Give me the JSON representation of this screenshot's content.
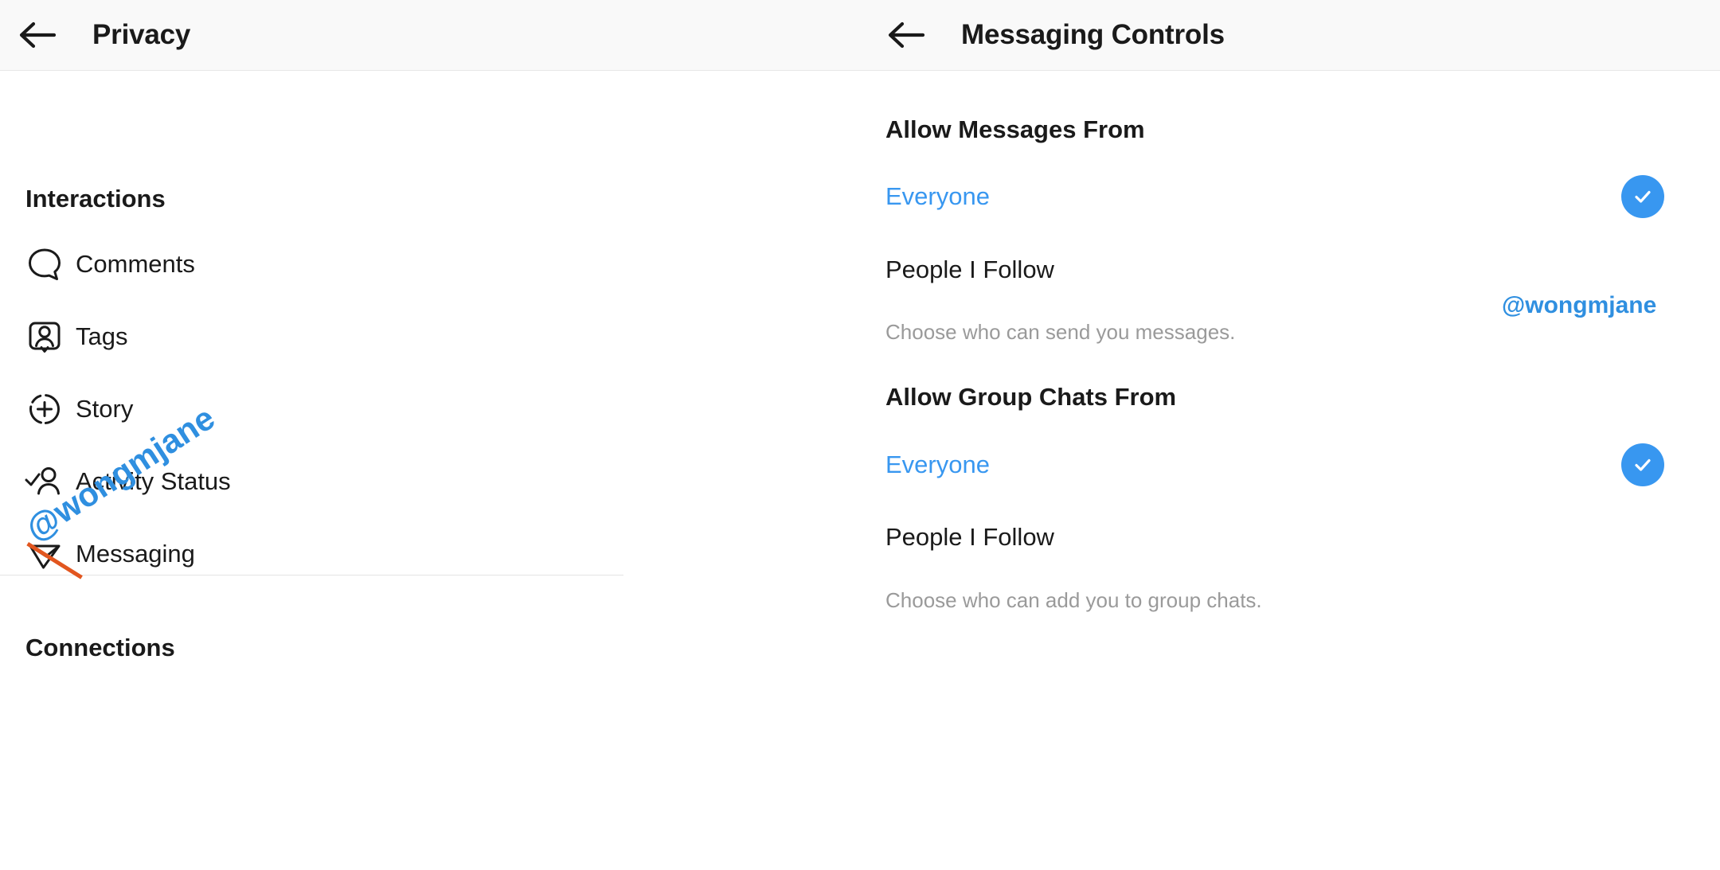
{
  "left_panel": {
    "header": {
      "back_icon": "back-arrow-icon",
      "title": "Privacy"
    },
    "sections": [
      {
        "title": "Interactions",
        "items": [
          {
            "label": "Comments",
            "icon": "comment-bubble-icon"
          },
          {
            "label": "Tags",
            "icon": "tag-person-icon"
          },
          {
            "label": "Story",
            "icon": "story-plus-circle-icon"
          },
          {
            "label": "Activity Status",
            "icon": "person-check-icon"
          },
          {
            "label": "Messaging",
            "icon": "paper-plane-icon"
          }
        ]
      },
      {
        "title": "Connections",
        "items": []
      }
    ]
  },
  "right_panel": {
    "header": {
      "back_icon": "back-arrow-icon",
      "title": "Messaging Controls"
    },
    "groups": [
      {
        "title": "Allow Messages From",
        "options": [
          {
            "label": "Everyone",
            "selected": true
          },
          {
            "label": "People I Follow",
            "selected": false
          }
        ],
        "help": "Choose who can send you messages."
      },
      {
        "title": "Allow Group Chats From",
        "options": [
          {
            "label": "Everyone",
            "selected": true
          },
          {
            "label": "People I Follow",
            "selected": false
          }
        ],
        "help": "Choose who can add you to group chats."
      }
    ]
  },
  "watermark": {
    "text": "@wongmjane"
  },
  "colors": {
    "accent": "#3897f0",
    "watermark": "#2f8fe0",
    "watermark_slash": "#e2561f",
    "header_bg": "#f9f9f9",
    "text_primary": "#1a1a1a",
    "text_muted": "#9a9a9a"
  }
}
